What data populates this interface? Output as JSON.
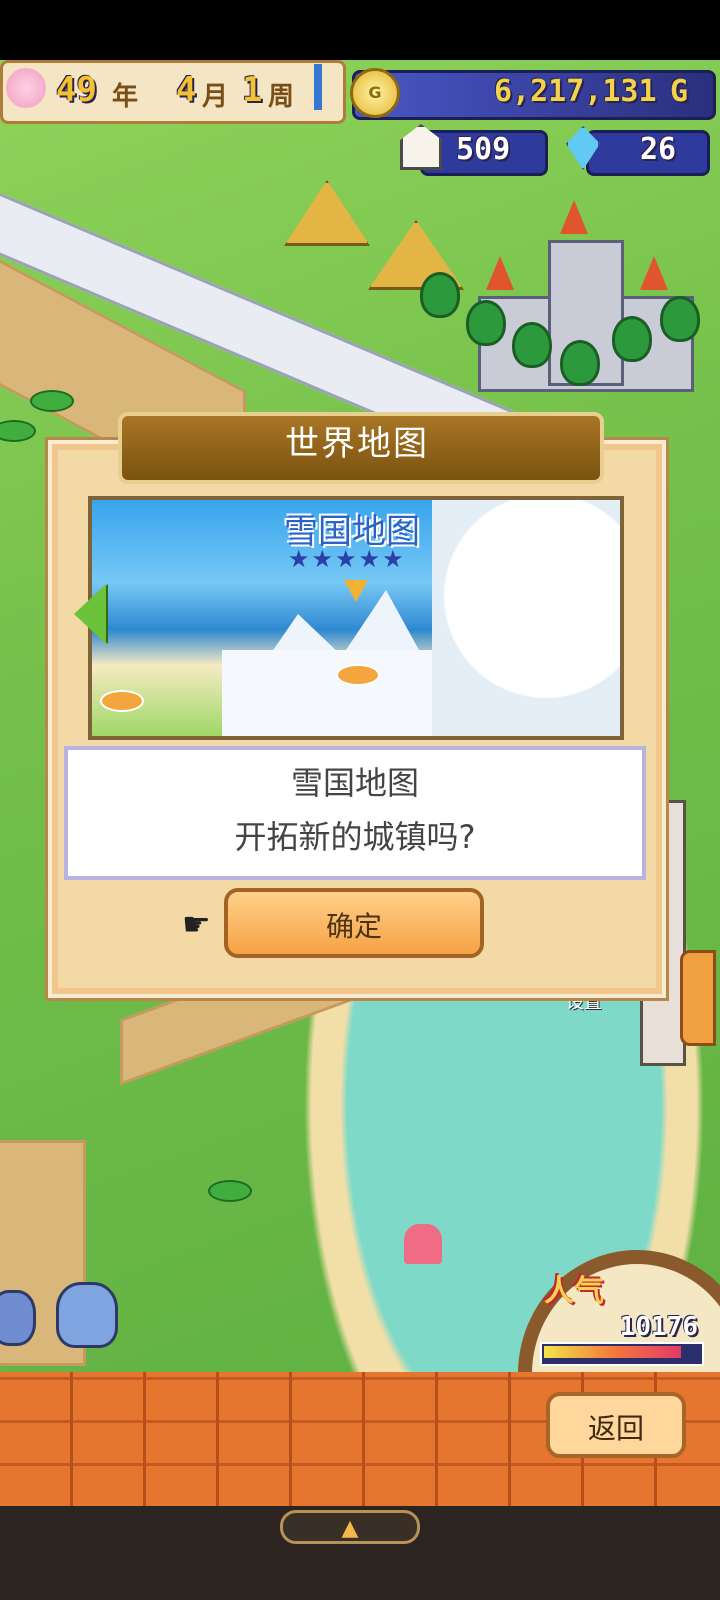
{
  "status_bar": {
    "year": "49",
    "year_unit": "年",
    "month": "4",
    "month_unit": "月",
    "week": "1",
    "week_unit": "周",
    "gold": "6,217,131",
    "gold_unit": "G",
    "houses": "509",
    "crystals": "26"
  },
  "dialog": {
    "title": "世界地图",
    "map_name": "雪国地图",
    "stars": "★★★★★",
    "message_line1": "雪国地图",
    "message_line2": "开拓新的城镇吗?",
    "confirm_label": "确定",
    "pointer_glyph": "☛"
  },
  "popularity": {
    "label": "人气",
    "value": "10176",
    "level": 0.9
  },
  "world_labels": {
    "setting_partial": "设置"
  },
  "bottom": {
    "back_label": "返回",
    "expand_glyph": "▲"
  },
  "colors": {
    "gold_bar": "#2e3a9c",
    "dialog_bg": "#f3d9a6",
    "confirm": "#f6a245",
    "brick": "#e6762f"
  },
  "icons": [
    "flower-icon",
    "gold-coin-icon",
    "house-icon",
    "crystal-icon",
    "hand-pointer-icon",
    "left-arrow-icon",
    "up-arrow-icon",
    "right-arrow-icon"
  ]
}
